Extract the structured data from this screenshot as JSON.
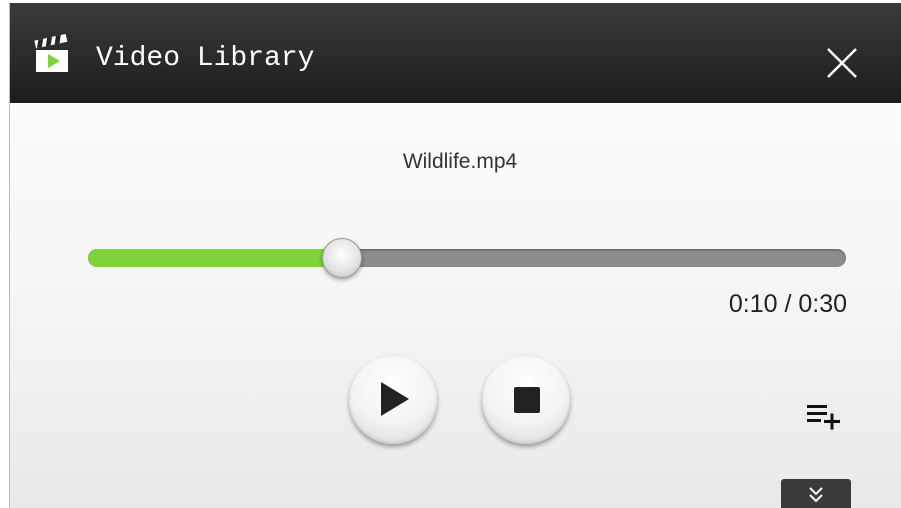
{
  "window": {
    "title": "Video Library",
    "app_icon": "clapperboard-play-icon",
    "close_icon": "close-icon"
  },
  "player": {
    "filename": "Wildlife.mp4",
    "progress_fraction": 0.3333,
    "time_display": "0:10 / 0:30",
    "colors": {
      "progress_fill": "#7ed43a",
      "track": "#8d8d8d",
      "titlebar": "#262626"
    }
  },
  "controls": {
    "play_icon": "play-icon",
    "stop_icon": "stop-icon",
    "playlist_add_icon": "playlist-add-icon",
    "expand_icon": "double-chevron-down-icon"
  }
}
